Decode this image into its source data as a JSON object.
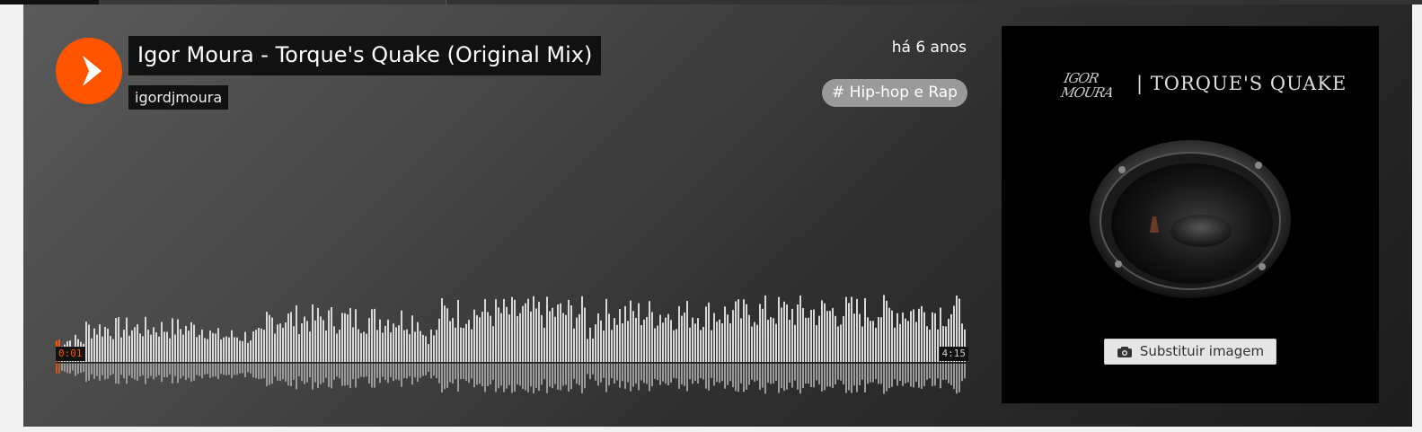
{
  "track": {
    "title": "Igor Moura - Torque's Quake (Original Mix)",
    "artist": "igordjmoura",
    "posted": "há 6 anos",
    "tag": "Hip-hop e Rap",
    "tag_prefix": "#"
  },
  "player": {
    "elapsed": "0:01",
    "duration": "4:15",
    "progress": 0.004
  },
  "artwork": {
    "logo_text": "| TORQUE'S QUAKE",
    "logo_script": "IGOR MOURA",
    "replace_label": "Substituir imagem"
  },
  "colors": {
    "accent": "#ff5500",
    "tag_bg": "#9a9a9a",
    "wave": "#d8d8d8"
  }
}
